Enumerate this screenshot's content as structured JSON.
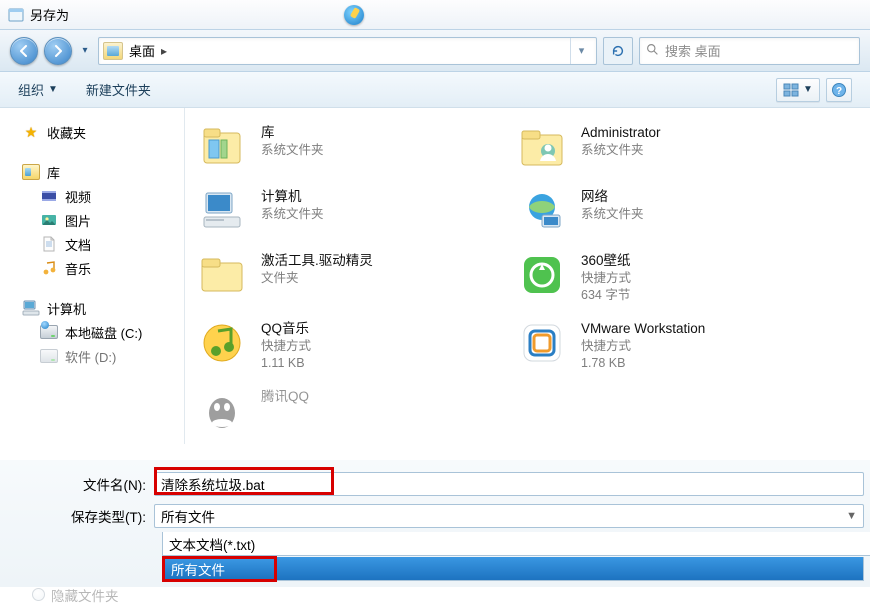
{
  "window": {
    "title": "另存为"
  },
  "nav": {
    "breadcrumb_location": "桌面",
    "search_placeholder": "搜索 桌面"
  },
  "toolbar": {
    "organize": "组织",
    "new_folder": "新建文件夹"
  },
  "sidebar": {
    "favorites_label": "收藏夹",
    "libraries_label": "库",
    "libraries": [
      {
        "label": "视频"
      },
      {
        "label": "图片"
      },
      {
        "label": "文档"
      },
      {
        "label": "音乐"
      }
    ],
    "computer_label": "计算机",
    "drives": [
      {
        "label": "本地磁盘 (C:)"
      },
      {
        "label": "软件 (D:)"
      }
    ]
  },
  "items_left": [
    {
      "name": "库",
      "sub": "系统文件夹"
    },
    {
      "name": "计算机",
      "sub": "系统文件夹"
    },
    {
      "name": "激活工具.驱动精灵",
      "sub": "文件夹"
    },
    {
      "name": "QQ音乐",
      "sub": "快捷方式",
      "sub2": "1.11 KB"
    },
    {
      "name": "腾讯QQ",
      "sub": ""
    }
  ],
  "items_right": [
    {
      "name": "Administrator",
      "sub": "系统文件夹"
    },
    {
      "name": "网络",
      "sub": "系统文件夹"
    },
    {
      "name": "360壁纸",
      "sub": "快捷方式",
      "sub2": "634 字节"
    },
    {
      "name": "VMware Workstation",
      "sub": "快捷方式",
      "sub2": "1.78 KB"
    }
  ],
  "save": {
    "filename_label": "文件名(N):",
    "filename_value": "清除系统垃圾.bat",
    "type_label": "保存类型(T):",
    "type_selected": "所有文件",
    "type_options": [
      "文本文档(*.txt)",
      "所有文件"
    ],
    "hide_folders_label": "隐藏文件夹"
  },
  "colors": {
    "accent": "#1d73c0",
    "highlight_box": "#d70000"
  }
}
